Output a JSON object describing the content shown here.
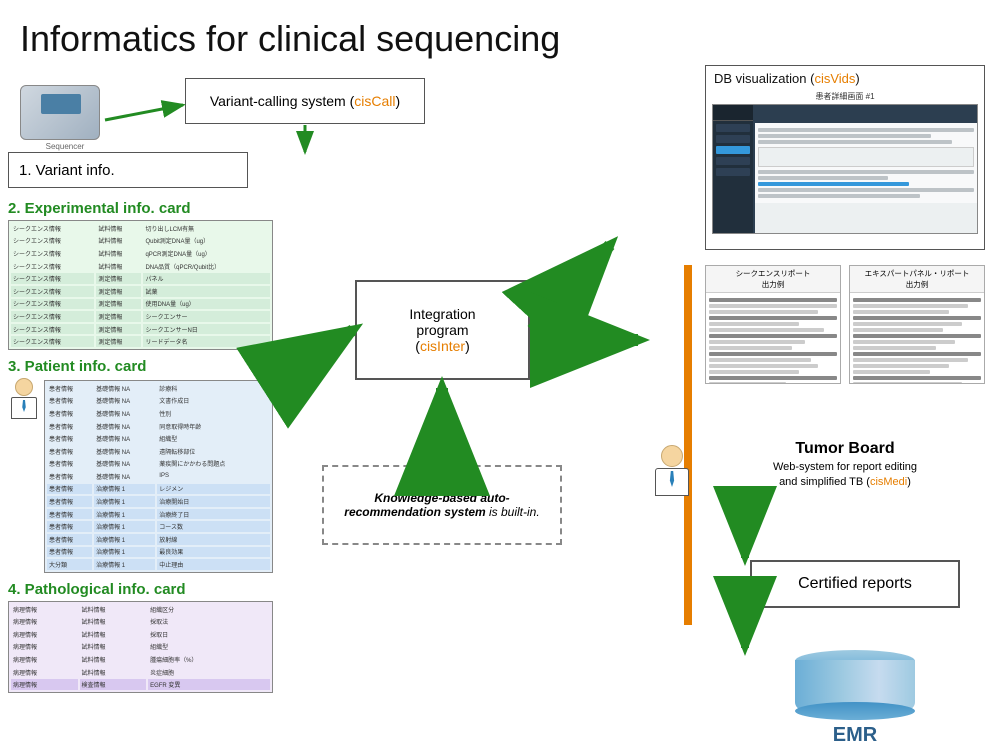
{
  "title": "Informatics for clinical sequencing",
  "variant_calling": {
    "label": "Variant-calling system (",
    "system_name": "cisCall",
    "closing": ")"
  },
  "variant_info": {
    "label": "1. Variant info."
  },
  "cards": {
    "experimental": {
      "number": "2.",
      "title": " Experimental info. card"
    },
    "patient": {
      "number": "3.",
      "title": " Patient info. card"
    },
    "pathological": {
      "number": "4.",
      "title": " Pathological info. card"
    }
  },
  "db_visualization": {
    "title": "DB visualization (",
    "system_name": "cisVids",
    "closing": ")",
    "screenshot_label": "患者詳細画面 #1"
  },
  "integration": {
    "line1": "Integration",
    "line2": "program",
    "prefix": "(",
    "system_name": "cisInter",
    "suffix": ")"
  },
  "knowledge": {
    "text": "Knowledge-based auto-recommendation system is built-in."
  },
  "report_previews": {
    "left_title": "シークエンスリポート\n出力例",
    "right_title": "エキスパートパネル・リポート\n出力例"
  },
  "tumor_board": {
    "title": "Tumor Board",
    "description": "Web-system for report editing\nand simplified TB (",
    "system_name": "cisMedi",
    "closing": ")"
  },
  "certified_reports": {
    "label": "Certified reports"
  },
  "emr": {
    "label": "EMR"
  },
  "experimental_rows": [
    [
      "シークエンス情報",
      "試料情報",
      "切り出しLCM有無"
    ],
    [
      "シークエンス情報",
      "試料情報",
      "Qubit測定DNA量（ug）"
    ],
    [
      "シークエンス情報",
      "試料情報",
      "qPCR測定DNA量（ug）"
    ],
    [
      "シークエンス情報",
      "試料情報",
      "DNA品質（qPCR/Qubit比）"
    ],
    [
      "シークエンス情報",
      "測定情報",
      "パネル"
    ],
    [
      "シークエンス情報",
      "測定情報",
      "試薬"
    ],
    [
      "シークエンス情報",
      "測定情報",
      "使用DNA量（ug）"
    ],
    [
      "シークエンス情報",
      "測定情報",
      "シークエンサー"
    ],
    [
      "シークエンス情報",
      "測定情報",
      "シークエンサーN日"
    ],
    [
      "シークエンス情報",
      "測定情報",
      "リードデータ名"
    ]
  ],
  "patient_rows": [
    [
      "患者情報",
      "基礎情報 NA",
      "診療科"
    ],
    [
      "患者情報",
      "基礎情報 NA",
      "文書作成日"
    ],
    [
      "患者情報",
      "基礎情報 NA",
      "性別"
    ],
    [
      "患者情報",
      "基礎情報 NA",
      "同意取得時年齢"
    ],
    [
      "患者情報",
      "基礎情報 NA",
      "組織型"
    ],
    [
      "患者情報",
      "基礎情報 NA",
      "遠隔転移部位"
    ],
    [
      "患者情報",
      "基礎情報 NA",
      "薬疾関にかかわる問題点"
    ],
    [
      "患者情報",
      "基礎情報 NA",
      "IPS"
    ],
    [
      "患者情報",
      "治療情報 1",
      "レジメン"
    ],
    [
      "患者情報",
      "治療情報 1",
      "治療開始日"
    ],
    [
      "患者情報",
      "治療情報 1",
      "治療終了日"
    ],
    [
      "患者情報",
      "治療情報 1",
      "コース数"
    ],
    [
      "患者情報",
      "治療情報 1",
      "放射線"
    ],
    [
      "患者情報",
      "治療情報 1",
      "最良効果"
    ],
    [
      "大分類",
      "治療情報 1",
      "中止理由"
    ]
  ],
  "pathological_rows": [
    [
      "病理情報",
      "試料情報",
      "組織区分"
    ],
    [
      "病理情報",
      "試料情報",
      "採取法"
    ],
    [
      "病理情報",
      "試料情報",
      "採取日"
    ],
    [
      "病理情報",
      "試料情報",
      "組織型"
    ],
    [
      "病理情報",
      "試料情報",
      "腫瘍細胞率（%）"
    ],
    [
      "病理情報",
      "試料情報",
      "炎症細胞"
    ],
    [
      "病理情報",
      "検査情報",
      "EGFR 変異"
    ]
  ],
  "colors": {
    "green_arrow": "#228B22",
    "orange": "#e67e00",
    "orange_bar": "#e67e00"
  }
}
